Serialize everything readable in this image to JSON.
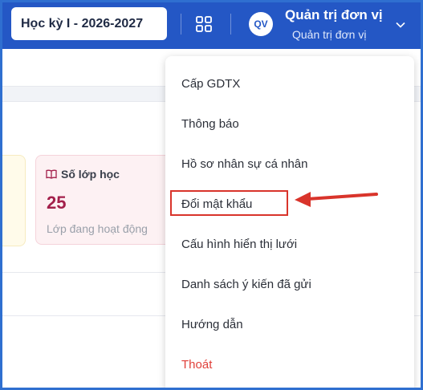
{
  "header": {
    "term_select": "Học kỳ I - 2026-2027",
    "apps_icon": "grid-apps-icon",
    "avatar_initials": "QV",
    "user_name": "Quản trị đơn vị",
    "user_role": "Quản trị đơn vị",
    "chevron_icon": "chevron-down-icon"
  },
  "stat_card": {
    "icon": "book-open-icon",
    "title": "Số lớp học",
    "value": "25",
    "subtitle": "Lớp đang hoạt động"
  },
  "menu": {
    "items": [
      {
        "label": "Cấp GDTX"
      },
      {
        "label": "Thông báo"
      },
      {
        "label": "Hồ sơ nhân sự cá nhân"
      },
      {
        "label": "Đổi mật khẩu"
      },
      {
        "label": "Cấu hình hiển thị lưới"
      },
      {
        "label": "Danh sách ý kiến đã gửi"
      },
      {
        "label": "Hướng dẫn"
      },
      {
        "label": "Thoát"
      }
    ]
  },
  "annotation": {
    "highlight_color": "#d9342b",
    "highlighted_item": "Đổi mật khẩu",
    "arrow_icon": "red-arrow-left-icon"
  },
  "colors": {
    "header_bg": "#2457c5",
    "logout_text": "#e0403a",
    "stat_value": "#a3204b"
  }
}
